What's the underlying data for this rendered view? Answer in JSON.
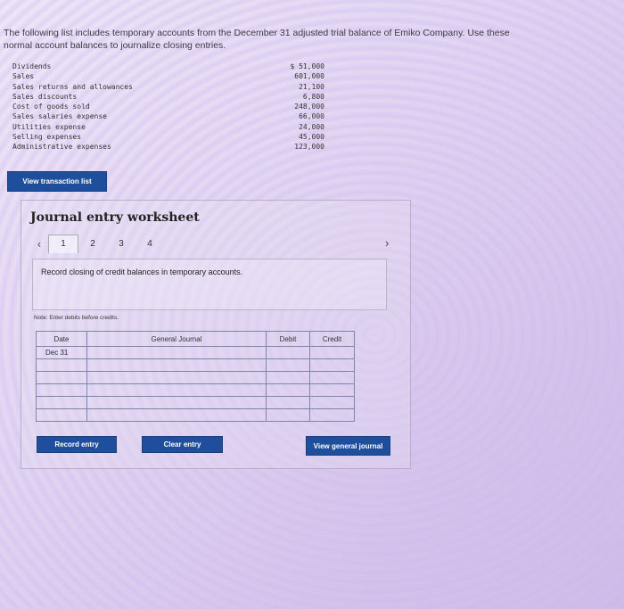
{
  "intro": "The following list includes temporary accounts from the December 31 adjusted trial balance of Emiko Company. Use these normal account balances to journalize closing entries.",
  "trial_balance": [
    {
      "account": "Dividends",
      "amount": "$ 51,000"
    },
    {
      "account": "Sales",
      "amount": "601,000"
    },
    {
      "account": "Sales returns and allowances",
      "amount": "21,100"
    },
    {
      "account": "Sales discounts",
      "amount": "6,800"
    },
    {
      "account": "Cost of goods sold",
      "amount": "248,000"
    },
    {
      "account": "Sales salaries expense",
      "amount": "66,000"
    },
    {
      "account": "Utilities expense",
      "amount": "24,000"
    },
    {
      "account": "Selling expenses",
      "amount": "45,000"
    },
    {
      "account": "Administrative expenses",
      "amount": "123,000"
    }
  ],
  "view_transaction_list": "View transaction list",
  "worksheet": {
    "title": "Journal entry worksheet",
    "tabs": [
      "1",
      "2",
      "3",
      "4"
    ],
    "active_tab": "1",
    "instruction": "Record closing of credit balances in temporary accounts.",
    "note": "Note: Enter debits before credits.",
    "columns": {
      "date": "Date",
      "account": "General Journal",
      "debit": "Debit",
      "credit": "Credit"
    },
    "first_date": "Dec 31",
    "buttons": {
      "record": "Record entry",
      "clear": "Clear entry",
      "view_journal": "View general journal"
    }
  },
  "icons": {
    "prev": "chevron-left-icon",
    "next": "chevron-right-icon"
  },
  "colors": {
    "button": "#1f4f9c"
  }
}
